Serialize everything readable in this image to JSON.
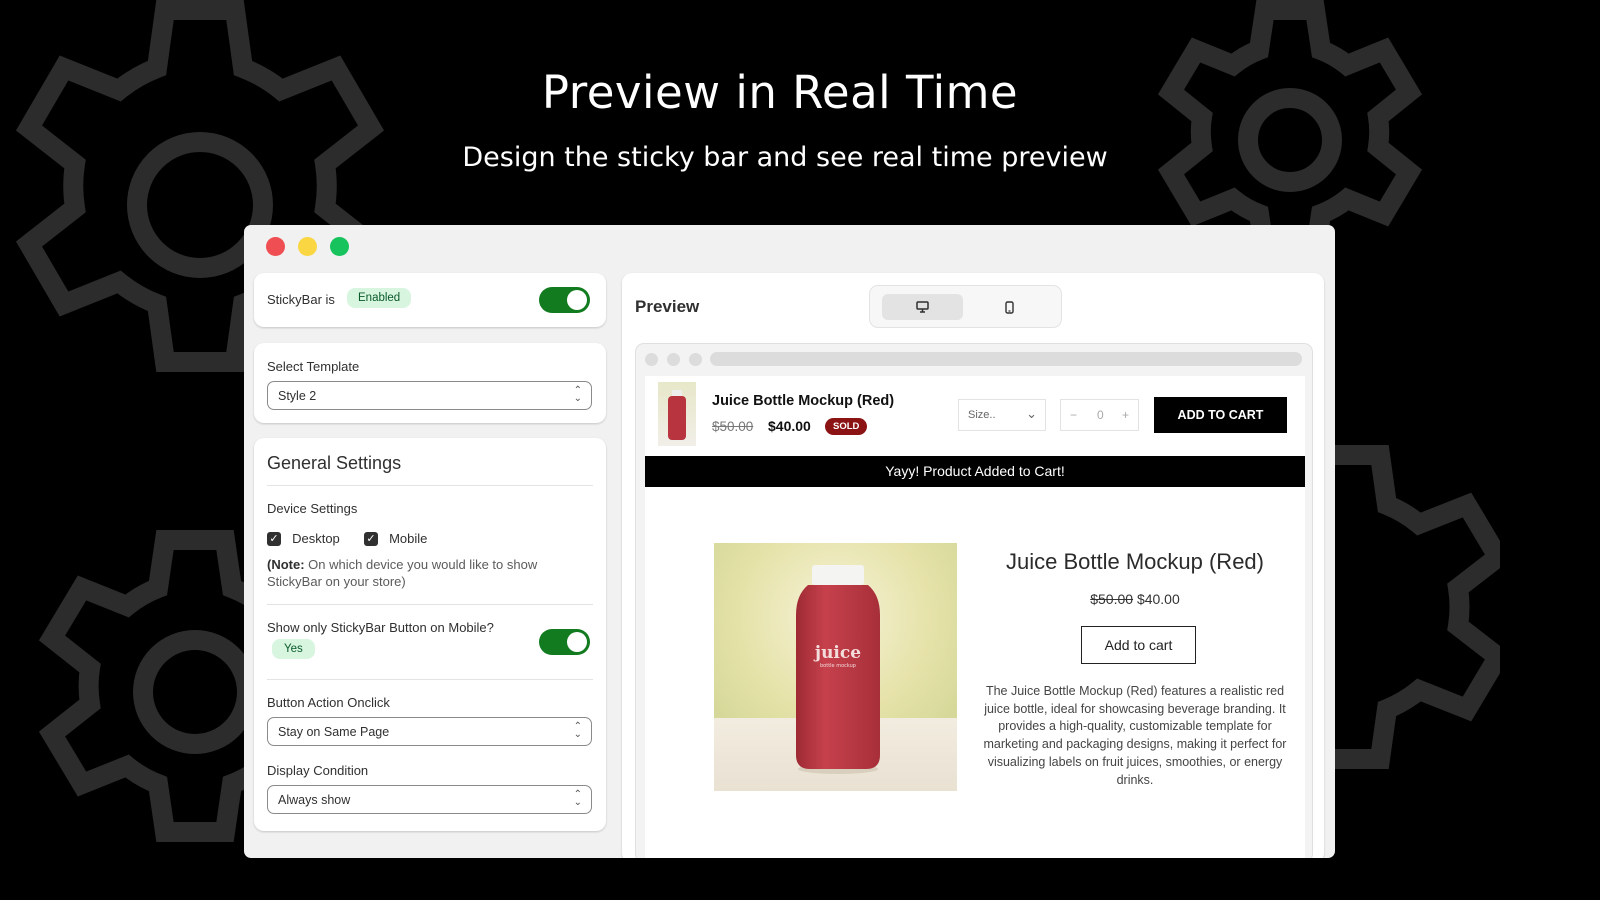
{
  "hero": {
    "title": "Preview in Real Time",
    "subtitle": "Design the sticky bar and see real time preview"
  },
  "settings": {
    "stickybar_label": "StickyBar is",
    "stickybar_status": "Enabled",
    "stickybar_enabled": true,
    "template_label": "Select Template",
    "template_value": "Style 2",
    "general_title": "General Settings",
    "device_label": "Device Settings",
    "desktop_label": "Desktop",
    "mobile_label": "Mobile",
    "desktop_checked": true,
    "mobile_checked": true,
    "note_bold": "(Note:",
    "note_text": " On which device you would like to show StickyBar on your store)",
    "mobile_button_label": "Show only StickyBar Button on Mobile?",
    "mobile_button_status": "Yes",
    "action_label": "Button Action Onclick",
    "action_value": "Stay on Same Page",
    "condition_label": "Display Condition",
    "condition_value": "Always show"
  },
  "preview": {
    "title": "Preview",
    "device_options": [
      "desktop-icon",
      "mobile-icon"
    ],
    "active_device": "desktop",
    "sticky": {
      "product_name": "Juice Bottle Mockup (Red)",
      "old_price": "$50.00",
      "price": "$40.00",
      "badge": "SOLD",
      "size_placeholder": "Size..",
      "qty_minus": "−",
      "qty_value": "0",
      "qty_plus": "+",
      "cta": "ADD TO CART"
    },
    "added_msg": "Yayy! Product Added to Cart!",
    "product": {
      "name": "Juice Bottle Mockup (Red)",
      "old_price": "$50.00",
      "price": "$40.00",
      "add_button": "Add to cart",
      "description": "The Juice Bottle Mockup (Red) features a realistic red juice bottle, ideal for showcasing beverage branding. It provides a high-quality, customizable template for marketing and packaging designs, making it perfect for visualizing labels on fruit juices, smoothies, or energy drinks.",
      "bottle_label": "juice",
      "bottle_sublabel": "bottle mockup"
    }
  },
  "colors": {
    "toggle_on": "#137b1f",
    "badge_bg": "#d7f5df",
    "sold_badge": "#8b1313",
    "bottle": "#b8343f"
  }
}
